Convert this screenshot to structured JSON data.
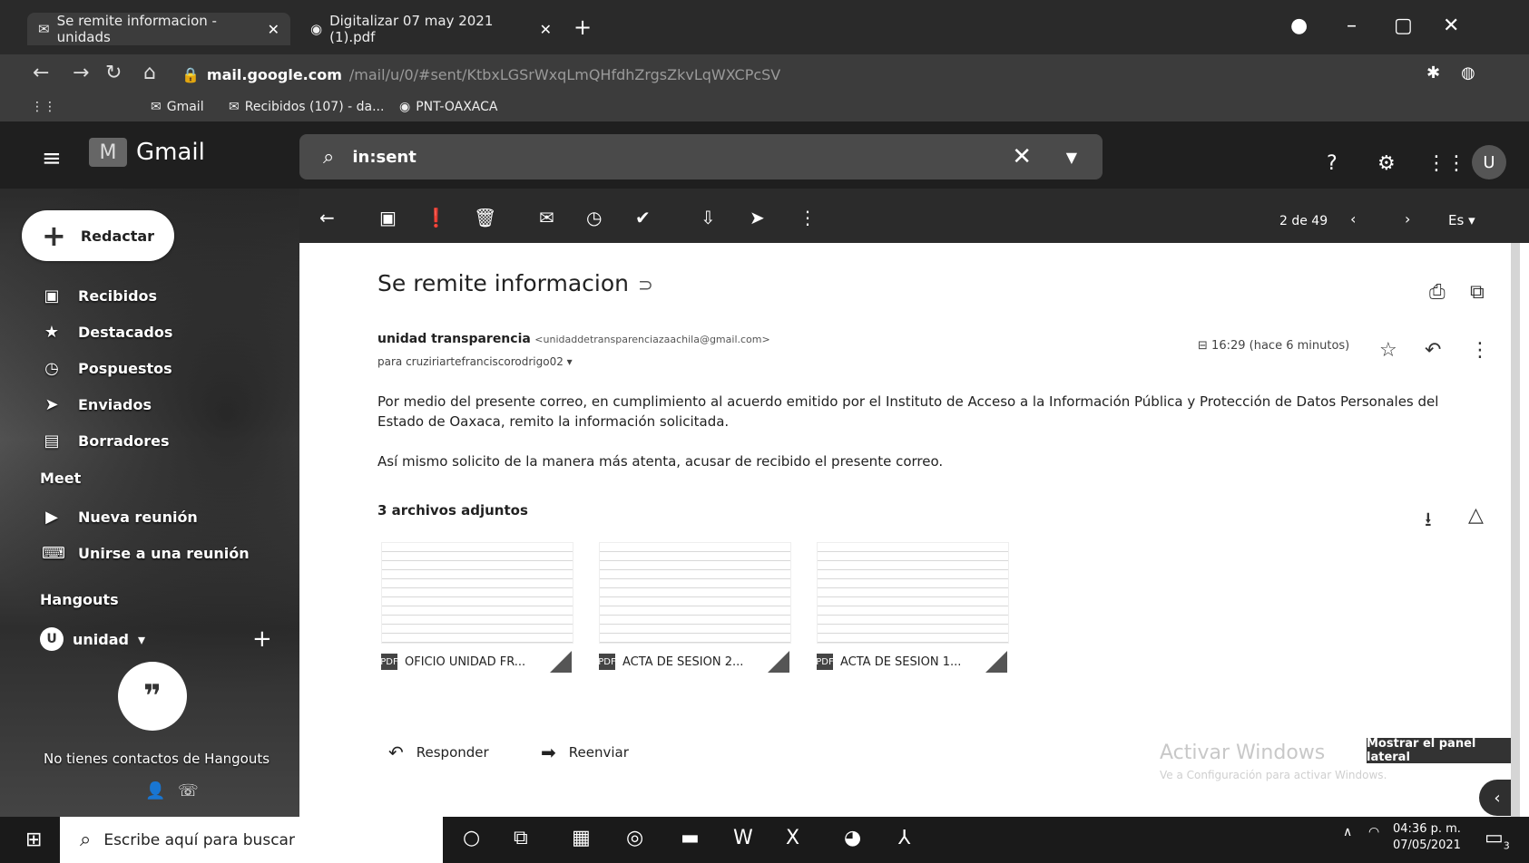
{
  "browser": {
    "tabs": [
      {
        "label": "Se remite informacion - unidads"
      },
      {
        "label": "Digitalizar 07 may 2021 (1).pdf"
      }
    ],
    "new_tab": "+",
    "url_host": "mail.google.com",
    "url_path": "/mail/u/0/#sent/KtbxLGSrWxqLmQHfdhZrgsZkvLqWXCPcSV",
    "bookmarks": [
      {
        "label": "Gmail"
      },
      {
        "label": "Recibidos (107) - da..."
      },
      {
        "label": "PNT-OAXACA"
      }
    ]
  },
  "gmail": {
    "logo": "Gmail",
    "search_value": "in:sent",
    "avatar": "U",
    "compose": "Redactar",
    "nav": [
      {
        "label": "Recibidos",
        "icon": "inbox-icon"
      },
      {
        "label": "Destacados",
        "icon": "star-icon"
      },
      {
        "label": "Pospuestos",
        "icon": "clock-icon"
      },
      {
        "label": "Enviados",
        "icon": "send-icon"
      },
      {
        "label": "Borradores",
        "icon": "draft-icon"
      }
    ],
    "meet_title": "Meet",
    "meet_items": [
      {
        "label": "Nueva reunión"
      },
      {
        "label": "Unirse a una reunión"
      }
    ],
    "hangouts_title": "Hangouts",
    "hangouts_user": "unidad",
    "hangouts_user_initial": "U",
    "hangouts_empty": "No tienes contactos de Hangouts",
    "pager": "2 de 49",
    "lang": "Es"
  },
  "mail": {
    "subject": "Se remite informacion",
    "sender_name": "unidad transparencia",
    "sender_email": "<unidaddetransparenciazaachila@gmail.com>",
    "to": "para cruziriartefranciscorodrigo02",
    "time": "16:29 (hace 6 minutos)",
    "body1": "Por medio del presente correo, en cumplimiento al acuerdo emitido por el Instituto de Acceso a la Información Pública y Protección de Datos Personales del Estado de Oaxaca, remito la información solicitada.",
    "body2": "Así mismo solicito de la manera más atenta, acusar de recibido el presente correo.",
    "attachments_count": "3 archivos adjuntos",
    "attachments": [
      {
        "name": "OFICIO UNIDAD FR..."
      },
      {
        "name": "ACTA DE SESION 2..."
      },
      {
        "name": "ACTA DE SESION 1..."
      }
    ],
    "reply": "Responder",
    "forward": "Reenviar"
  },
  "overlay": {
    "activate_title": "Activar Windows",
    "activate_sub": "Ve a Configuración para activar Windows.",
    "side_panel": "Mostrar el panel lateral"
  },
  "taskbar": {
    "search_placeholder": "Escribe aquí para buscar",
    "time": "04:36 p. m.",
    "date": "07/05/2021",
    "notif_count": "3"
  },
  "colors": {
    "chrome_dark": "#2a2a2a",
    "gmail_header": "#1f1f1f",
    "taskbar": "#1a1a1a"
  }
}
